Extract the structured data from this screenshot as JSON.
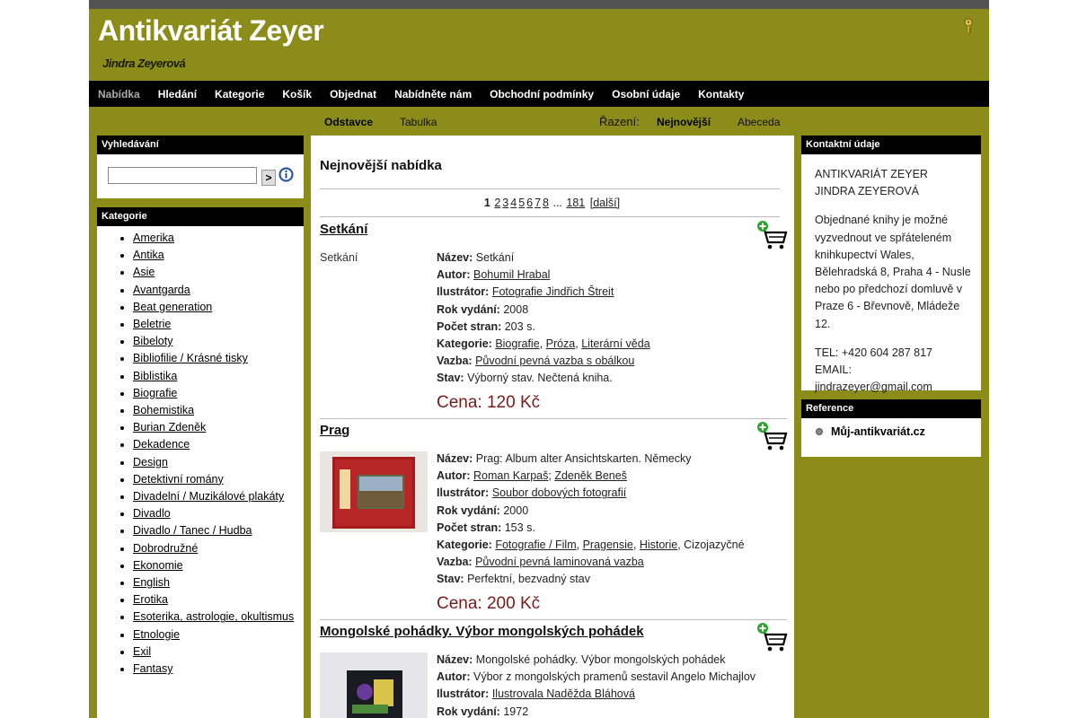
{
  "header": {
    "title": "Antikvariát Zeyer",
    "subtitle": "Jindra Zeyerová"
  },
  "nav": [
    "Nabídka",
    "Hledání",
    "Kategorie",
    "Košík",
    "Objednat",
    "Nabídněte nám",
    "Obchodní podmínky",
    "Osobní údaje",
    "Kontakty"
  ],
  "subnav": {
    "view_odstavce": "Odstavce",
    "view_tabulka": "Tabulka",
    "sort_label": "Řazení:",
    "sort_newest": "Nejnovější",
    "sort_alpha": "Abeceda"
  },
  "search": {
    "header": "Vyhledávání",
    "button": ">",
    "value": ""
  },
  "categories": {
    "header": "Kategorie",
    "items": [
      "Amerika",
      "Antika",
      "Asie",
      "Avantgarda",
      "Beat generation",
      "Beletrie",
      "Bibeloty",
      "Bibliofilie / Krásné tisky",
      "Biblistika",
      "Biografie",
      "Bohemistika",
      "Burian Zdeněk",
      "Dekadence",
      "Design",
      "Detektivní romány",
      "Divadelní / Muzikálové plakáty",
      "Divadlo",
      "Divadlo / Tanec / Hudba",
      "Dobrodružné",
      "Ekonomie",
      "English",
      "Erotika",
      "Esoterika, astrologie, okultismus",
      "Etnologie",
      "Exil",
      "Fantasy"
    ]
  },
  "main": {
    "title": "Nejnovější nabídka",
    "pager": {
      "current": "1",
      "pages": [
        "2",
        "3",
        "4",
        "5",
        "6",
        "7",
        "8"
      ],
      "ellipsis": "...",
      "last": "181",
      "next": "[další]"
    },
    "labels": {
      "name": "Název:",
      "author": "Autor:",
      "illustrator": "Ilustrátor:",
      "year": "Rok vydání:",
      "pages": "Počet stran:",
      "category": "Kategorie:",
      "binding": "Vazba:",
      "state": "Stav:"
    },
    "items": [
      {
        "title": "Setkání",
        "img_alt": "Setkání",
        "name": "Setkání",
        "author": "Bohumil Hrabal",
        "illustrator": "Fotografie Jindřich Štreit",
        "year": "2008",
        "pages": "203 s.",
        "cat1": "Biografie",
        "cat2": "Próza",
        "cat3": "Literární věda",
        "binding": "Původní pevná vazba s obálkou",
        "state": "Výborný stav. Nečtená kniha.",
        "price": "Cena: 120 Kč"
      },
      {
        "title": "Prag",
        "name": "Prag: Album alter Ansichtskarten. Německy",
        "author1": "Roman Karpaš",
        "author2": "Zdeněk Beneš",
        "illustrator": "Soubor dobových fotografií",
        "year": "2000",
        "pages": "153 s.",
        "cat1": "Fotografie / Film",
        "cat2": "Pragensie",
        "cat3": "Historie",
        "cat4": "Cizojazyčné",
        "binding": "Původní pevná laminovaná vazba",
        "state": "Perfektní, bezvadný stav",
        "price": "Cena: 200 Kč"
      },
      {
        "title": "Mongolské pohádky. Výbor mongolských pohádek",
        "name": "Mongolské pohádky. Výbor mongolských pohádek",
        "author": "Výbor z mongolských pramenů sestavil Angelo Michajlov",
        "illustrator": "Ilustrovala Naděžda Bláhová",
        "year": "1972"
      }
    ]
  },
  "contact": {
    "header": "Kontaktní údaje",
    "line1": "ANTIKVARIÁT ZEYER",
    "line2": "JINDRA ZEYEROVÁ",
    "pickup": "Objednané knihy je možné vyzvednout ve spřáteleném knihkupectví Wales, Bělehradská 8, Praha 4 - Nusle nebo po předchozí domluvě v Praze 6 - Břevnově, Mládeže 12.",
    "tel": "TEL: +420 604 287 817",
    "email": "EMAIL: jindrazeyer@gmail.com"
  },
  "reference": {
    "header": "Reference",
    "link": "Můj-antikvariát.cz"
  },
  "colors": {
    "page_bg": "#8c8c1a",
    "nav_bg": "#000000",
    "price": "#7b1a1a"
  }
}
